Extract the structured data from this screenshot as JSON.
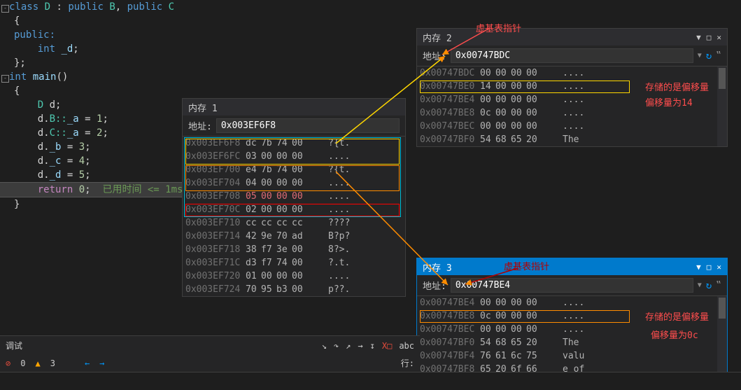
{
  "code": {
    "l1": {
      "class": "class ",
      "d": "D",
      "colon": " : ",
      "pub": "public ",
      "b": "B",
      "comma": ", ",
      "pub2": "public ",
      "c": "C"
    },
    "l2": "{",
    "l3": "public:",
    "l4_kw": "    int ",
    "l4_id": "_d",
    "l4_sc": ";",
    "l5": "};",
    "l6_kw": "int ",
    "l6_id": "main",
    "l6_p": "()",
    "l7": "{",
    "l8": "    D d;",
    "l9_a": "    d.",
    "l9_b": "B::",
    "l9_c": "_a ",
    "l9_d": "= ",
    "l9_e": "1",
    "l9_f": ";",
    "l10_a": "    d.",
    "l10_b": "C::",
    "l10_c": "_a ",
    "l10_d": "= ",
    "l10_e": "2",
    "l10_f": ";",
    "l11_a": "    d.",
    "l11_c": "_b ",
    "l11_d": "= ",
    "l11_e": "3",
    "l11_f": ";",
    "l12_a": "    d.",
    "l12_c": "_c ",
    "l12_d": "= ",
    "l12_e": "4",
    "l12_f": ";",
    "l13_a": "    d.",
    "l13_c": "_d ",
    "l13_d": "= ",
    "l13_e": "5",
    "l13_f": ";",
    "l14_kw": "    return ",
    "l14_n": "0",
    "l14_sc": ";",
    "l14_cmt": "  已用时间 <= 1ms",
    "l15": "}"
  },
  "mem1": {
    "title": "内存 1",
    "addr_label": "地址:",
    "addr": "0x003EF6F8",
    "rows": [
      {
        "a": "0x003EF6F8",
        "b": [
          "dc",
          "7b",
          "74",
          "00"
        ],
        "t": "?{t."
      },
      {
        "a": "0x003EF6FC",
        "b": [
          "03",
          "00",
          "00",
          "00"
        ],
        "t": "...."
      },
      {
        "a": "0x003EF700",
        "b": [
          "e4",
          "7b",
          "74",
          "00"
        ],
        "t": "?{t."
      },
      {
        "a": "0x003EF704",
        "b": [
          "04",
          "00",
          "00",
          "00"
        ],
        "t": "...."
      },
      {
        "a": "0x003EF708",
        "b": [
          "05",
          "00",
          "00",
          "00"
        ],
        "t": "....",
        "red": true
      },
      {
        "a": "0x003EF70C",
        "b": [
          "02",
          "00",
          "00",
          "00"
        ],
        "t": "...."
      },
      {
        "a": "0x003EF710",
        "b": [
          "cc",
          "cc",
          "cc",
          "cc"
        ],
        "t": "????"
      },
      {
        "a": "0x003EF714",
        "b": [
          "42",
          "9e",
          "70",
          "ad"
        ],
        "t": "B?p?"
      },
      {
        "a": "0x003EF718",
        "b": [
          "38",
          "f7",
          "3e",
          "00"
        ],
        "t": "8?>."
      },
      {
        "a": "0x003EF71C",
        "b": [
          "d3",
          "f7",
          "74",
          "00"
        ],
        "t": "?.t."
      },
      {
        "a": "0x003EF720",
        "b": [
          "01",
          "00",
          "00",
          "00"
        ],
        "t": "...."
      },
      {
        "a": "0x003EF724",
        "b": [
          "70",
          "95",
          "b3",
          "00"
        ],
        "t": "p??."
      }
    ]
  },
  "mem2": {
    "title": "内存 2",
    "addr_label": "地址:",
    "addr": "0x00747BDC",
    "rows": [
      {
        "a": "0x00747BDC",
        "b": [
          "00",
          "00",
          "00",
          "00"
        ],
        "t": "...."
      },
      {
        "a": "0x00747BE0",
        "b": [
          "14",
          "00",
          "00",
          "00"
        ],
        "t": "...."
      },
      {
        "a": "0x00747BE4",
        "b": [
          "00",
          "00",
          "00",
          "00"
        ],
        "t": "...."
      },
      {
        "a": "0x00747BE8",
        "b": [
          "0c",
          "00",
          "00",
          "00"
        ],
        "t": "...."
      },
      {
        "a": "0x00747BEC",
        "b": [
          "00",
          "00",
          "00",
          "00"
        ],
        "t": "...."
      },
      {
        "a": "0x00747BF0",
        "b": [
          "54",
          "68",
          "65",
          "20"
        ],
        "t": "The "
      }
    ]
  },
  "mem3": {
    "title": "内存 3",
    "addr_label": "地址:",
    "addr": "0x00747BE4",
    "rows": [
      {
        "a": "0x00747BE4",
        "b": [
          "00",
          "00",
          "00",
          "00"
        ],
        "t": "...."
      },
      {
        "a": "0x00747BE8",
        "b": [
          "0c",
          "00",
          "00",
          "00"
        ],
        "t": "...."
      },
      {
        "a": "0x00747BEC",
        "b": [
          "00",
          "00",
          "00",
          "00"
        ],
        "t": "...."
      },
      {
        "a": "0x00747BF0",
        "b": [
          "54",
          "68",
          "65",
          "20"
        ],
        "t": "The "
      },
      {
        "a": "0x00747BF4",
        "b": [
          "76",
          "61",
          "6c",
          "75"
        ],
        "t": "valu"
      },
      {
        "a": "0x00747BF8",
        "b": [
          "65",
          "20",
          "6f",
          "66"
        ],
        "t": "e of"
      }
    ]
  },
  "annotations": {
    "vbptr": "虚基表指针",
    "vbptr2": "虚基表指针",
    "offset_store": "存储的是偏移量",
    "offset_14": "偏移量为14",
    "offset_store2": "存储的是偏移量",
    "offset_0c": "偏移量为0c"
  },
  "err_bar": {
    "err_count": "0",
    "warn_count": "3"
  },
  "status": {
    "line_label": "行:"
  },
  "debug": {
    "label": "调试"
  }
}
